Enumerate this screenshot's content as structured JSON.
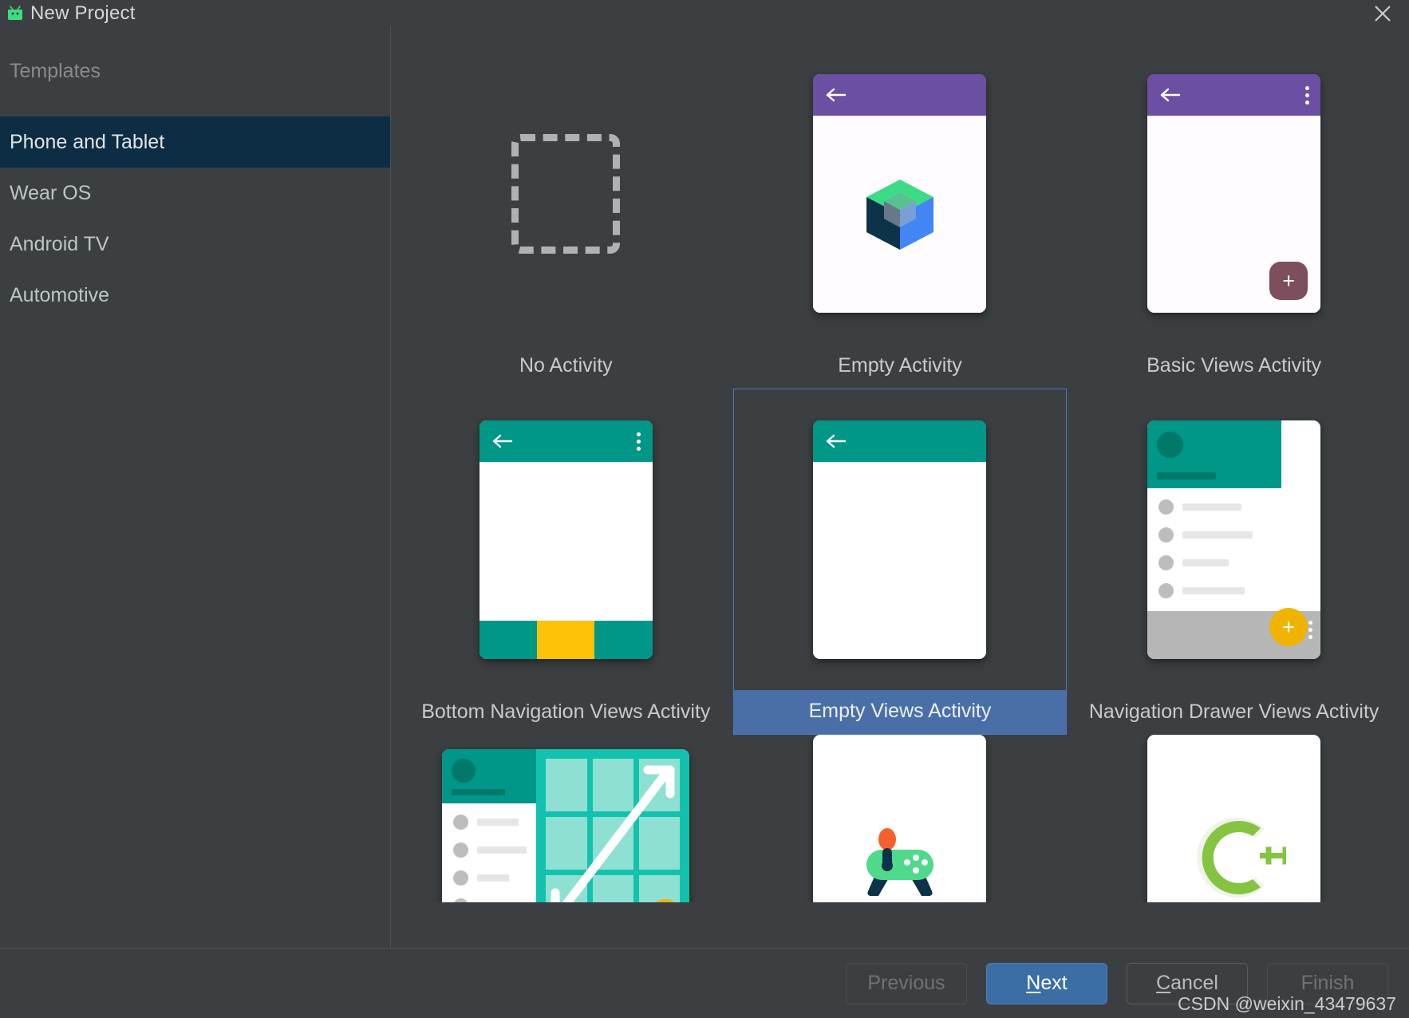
{
  "window": {
    "title": "New Project",
    "app_icon": "android-robot-icon",
    "close_label": "✕"
  },
  "sidebar": {
    "heading": "Templates",
    "items": [
      {
        "label": "Phone and Tablet",
        "selected": true
      },
      {
        "label": "Wear OS",
        "selected": false
      },
      {
        "label": "Android TV",
        "selected": false
      },
      {
        "label": "Automotive",
        "selected": false
      }
    ]
  },
  "gallery": {
    "selected_template": "Empty Views Activity",
    "templates": [
      {
        "label": "No Activity",
        "thumb": "dashed-placeholder",
        "selected": false
      },
      {
        "label": "Empty Activity",
        "thumb": "compose-phone",
        "selected": false
      },
      {
        "label": "Basic Views Activity",
        "thumb": "basic-views-phone",
        "selected": false
      },
      {
        "label": "Bottom Navigation Views Activity",
        "thumb": "bottom-nav-phone",
        "selected": false
      },
      {
        "label": "Empty Views Activity",
        "thumb": "empty-views-phone",
        "selected": true
      },
      {
        "label": "Navigation Drawer Views Activity",
        "thumb": "nav-drawer-phone",
        "selected": false
      },
      {
        "label": "",
        "thumb": "responsive-views-card",
        "selected": false
      },
      {
        "label": "",
        "thumb": "game-activity-card",
        "selected": false
      },
      {
        "label": "",
        "thumb": "native-cpp-card",
        "selected": false
      }
    ]
  },
  "footer": {
    "previous": "Previous",
    "next_pre": "N",
    "next_post": "ext",
    "cancel_pre": "C",
    "cancel_post": "ancel",
    "finish": "Finish",
    "watermark": "CSDN @weixin_43479637"
  },
  "colors": {
    "dialog_bg": "#3c3f41",
    "sidebar_selected": "#0d2d44",
    "selection_border": "#4a79c4",
    "selection_label": "#4a6fa8",
    "primary_button": "#3b6ea5",
    "appbar_purple": "#6a4fa3",
    "appbar_teal": "#009688",
    "accent_amber": "#ffc107",
    "fab_mauve": "#7d4e5c"
  }
}
